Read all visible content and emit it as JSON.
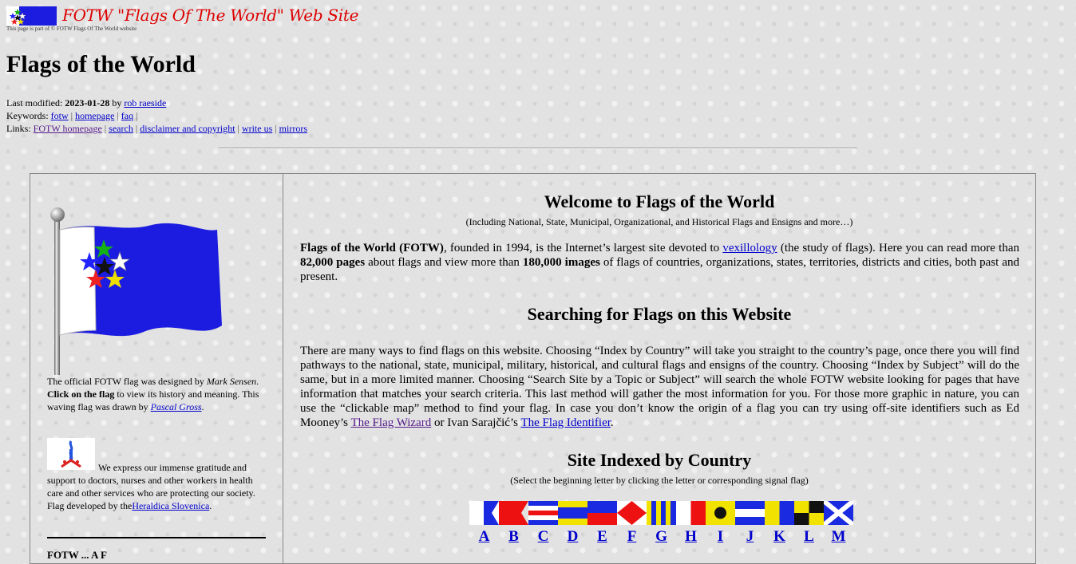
{
  "banner": {
    "title": "FOTW  \"Flags Of The World\" Web Site",
    "subtitle": "This page is part of © FOTW Flags Of The World website"
  },
  "page_title": "Flags of the World",
  "meta": {
    "modified_label": "Last modified: ",
    "modified_date": "2023-01-28",
    "by": " by ",
    "author": "rob raeside",
    "keywords_label": "Keywords: ",
    "keywords": [
      "fotw",
      "homepage",
      "faq"
    ],
    "links_label": "Links: ",
    "links": [
      "FOTW homepage",
      "search",
      "disclaimer and copyright",
      "write us",
      "mirrors"
    ],
    "separator": " | "
  },
  "sidebar": {
    "caption1": {
      "t1": "The official FOTW flag was designed by ",
      "designer": "Mark Sensen",
      "t2": ". ",
      "bold": "Click on the flag",
      "t3": " to view its history and meaning. This waving flag was drawn by ",
      "artist": "Pascal Gross",
      "t4": "."
    },
    "caption2": {
      "text": "We express our immense gratitude and support to doctors, nurses and other workers in health care and other services who are protecting our society.",
      "text2": "Flag developed by the ",
      "link": "Heraldica Slovenica",
      "t_end": "."
    },
    "next_heading": "FOTW ... A F"
  },
  "main": {
    "welcome_title": "Welcome to Flags of the World",
    "welcome_note": "(Including National, State, Municipal, Organizational, and Historical Flags and Ensigns and more…)",
    "intro": {
      "b1": "Flags of the World (FOTW)",
      "t1": ", founded in 1994, is the Internet’s largest site devoted to ",
      "link": "vexillology",
      "t2": " (the study of flags). Here you can read more than ",
      "b2": "82,000 pages",
      "t3": " about flags and view more than ",
      "b3": "180,000 images",
      "t4": " of flags of countries, organizations, states, territories, districts and cities, both past and present."
    },
    "search_title": "Searching for Flags on this Website",
    "search": {
      "t1": "There are many ways to find flags on this website. Choosing “Index by Country” will take you straight to the country’s page, once there you will find pathways to the national, state, municipal, military, historical, and cultural flags and ensigns of the country. Choosing “Index by Subject” will do the same, but in a more limited manner. Choosing “Search Site by a Topic or Subject” will search the whole FOTW website looking for pages that have information that matches your search criteria. This last method will gather the most information for you. For those more graphic in nature, you can use the “clickable map” method to find your flag. In case you don’t know the origin of a flag you can try using off-site identifiers such as Ed Mooney’s ",
      "link1": "The Flag Wizard",
      "t2": " or Ivan Sarajčić’s ",
      "link2": "The Flag Identifier",
      "t3": "."
    },
    "index_title": "Site Indexed by Country",
    "index_note": "(Select the beginning letter by clicking the letter or corresponding signal flag)",
    "letters": [
      "A",
      "B",
      "C",
      "D",
      "E",
      "F",
      "G",
      "H",
      "I",
      "J",
      "K",
      "L",
      "M"
    ]
  },
  "colors": {
    "banner_red": "#dd0000",
    "fotw_blue": "#1c1ce0",
    "link": "#0000cc",
    "visited": "#551a8b"
  }
}
